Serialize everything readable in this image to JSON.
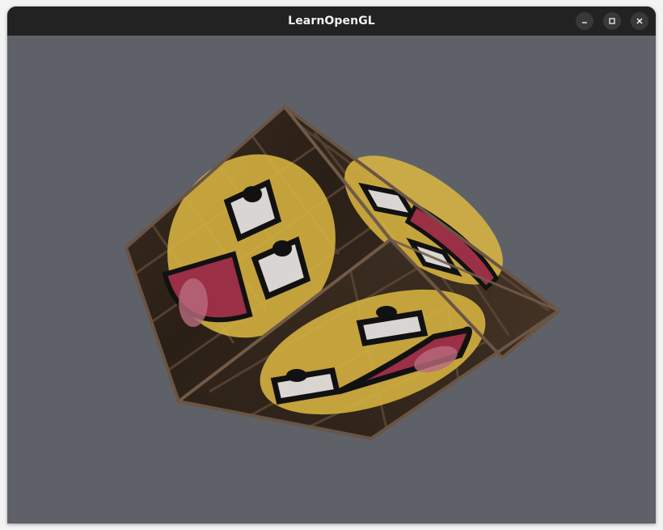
{
  "window": {
    "title": "LearnOpenGL",
    "controls": [
      {
        "name": "minimize-button",
        "icon": "minimize-icon"
      },
      {
        "name": "maximize-button",
        "icon": "maximize-icon"
      },
      {
        "name": "close-button",
        "icon": "close-icon"
      }
    ]
  },
  "viewport": {
    "clear_color": "#5f6168",
    "scene": "rotating-textured-cube",
    "texture_colors": {
      "wood_dark": "#2b2119",
      "wood_frame": "#5b4636",
      "face_yellow": "#d8b441",
      "mouth_red": "#9a2f46",
      "eye_white": "#d9d5d2"
    }
  }
}
